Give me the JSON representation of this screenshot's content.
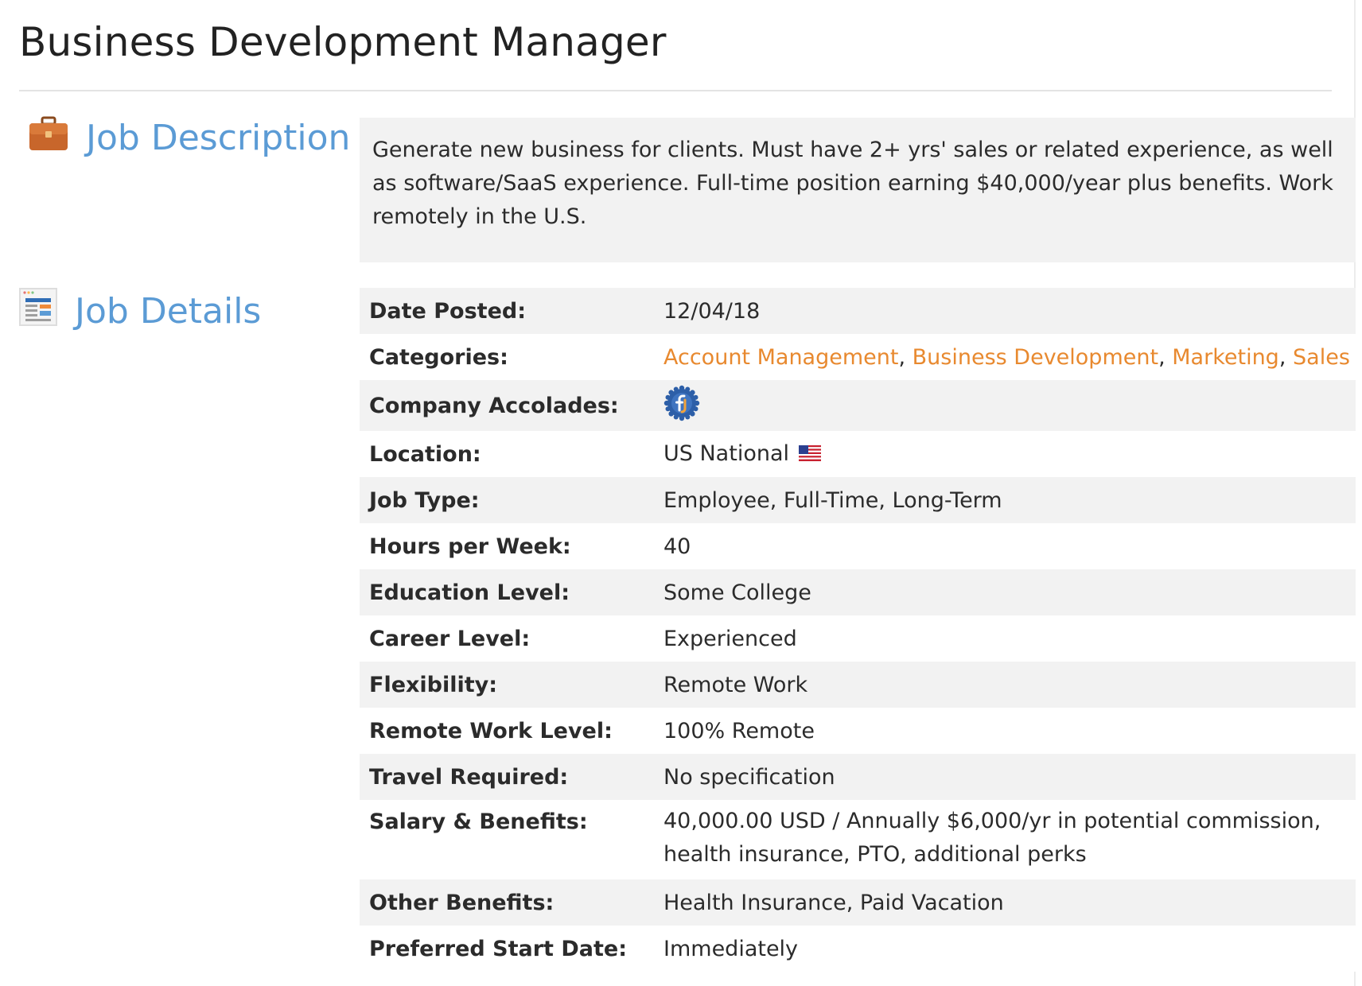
{
  "page": {
    "title": "Business Development Manager"
  },
  "sections": {
    "description": {
      "heading": "Job Description",
      "icon": "briefcase-icon",
      "text": "Generate new business for clients. Must have 2+ yrs' sales or related experience, as well as software/SaaS experience. Full-time position earning $40,000/year plus benefits. Work remotely in the U.S."
    },
    "details": {
      "heading": "Job Details",
      "icon": "document-list-icon"
    }
  },
  "details": {
    "date_posted": {
      "label": "Date Posted:",
      "value": "12/04/18"
    },
    "categories": {
      "label": "Categories:",
      "items": [
        "Account Management",
        "Business Development",
        "Marketing",
        "Sales"
      ],
      "separator": ","
    },
    "accolades": {
      "label": "Company Accolades:",
      "icon": "fj-badge-icon"
    },
    "location": {
      "label": "Location:",
      "value": "US National",
      "icon": "us-flag-icon"
    },
    "job_type": {
      "label": "Job Type:",
      "value": "Employee, Full-Time, Long-Term"
    },
    "hours": {
      "label": "Hours per Week:",
      "value": "40"
    },
    "education": {
      "label": "Education Level:",
      "value": "Some College"
    },
    "career": {
      "label": "Career Level:",
      "value": "Experienced"
    },
    "flexibility": {
      "label": "Flexibility:",
      "value": "Remote Work"
    },
    "remote_level": {
      "label": "Remote Work Level:",
      "value": "100% Remote"
    },
    "travel": {
      "label": "Travel Required:",
      "value": "No specification"
    },
    "salary": {
      "label": "Salary & Benefits:",
      "value": "40,000.00 USD / Annually $6,000/yr in potential commission, health insurance, PTO, additional perks"
    },
    "other_benefits": {
      "label": "Other Benefits:",
      "value": "Health Insurance, Paid Vacation"
    },
    "start_date": {
      "label": "Preferred Start Date:",
      "value": "Immediately"
    }
  },
  "colors": {
    "heading_blue": "#5b9bd5",
    "link_orange": "#e8892f",
    "row_gray": "#f2f2f2"
  }
}
